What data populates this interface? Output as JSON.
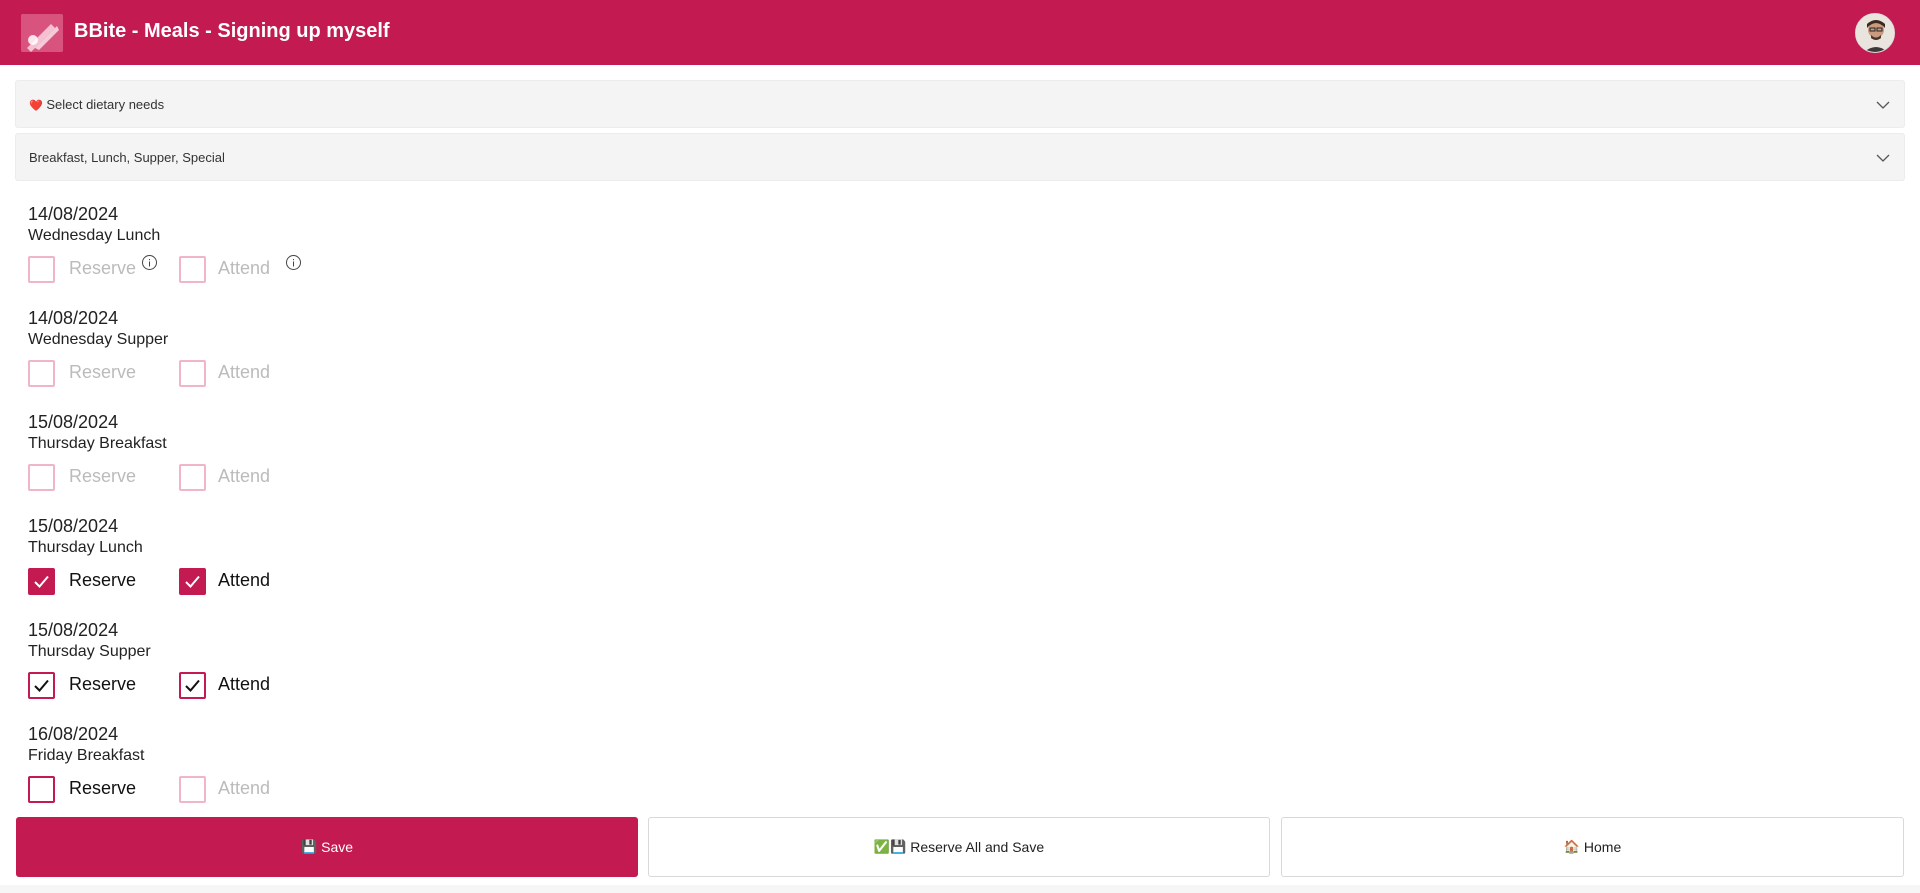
{
  "app": {
    "title": "BBite - Meals - Signing up myself"
  },
  "panels": {
    "dietary_icon": "❤️",
    "dietary_label": "Select dietary needs",
    "meal_types_label": "Breakfast, Lunch, Supper, Special"
  },
  "meals": [
    {
      "date": "14/08/2024",
      "name": "Wednesday Lunch",
      "reserve_label": "Reserve",
      "attend_label": "Attend",
      "reserve_checked": false,
      "attend_checked": false,
      "info_icons": true
    },
    {
      "date": "14/08/2024",
      "name": "Wednesday Supper",
      "reserve_label": "Reserve",
      "attend_label": "Attend",
      "reserve_checked": false,
      "attend_checked": false
    },
    {
      "date": "15/08/2024",
      "name": "Thursday Breakfast",
      "reserve_label": "Reserve",
      "attend_label": "Attend",
      "reserve_checked": false,
      "attend_checked": false
    },
    {
      "date": "15/08/2024",
      "name": "Thursday Lunch",
      "reserve_label": "Reserve",
      "attend_label": "Attend",
      "reserve_checked": true,
      "attend_checked": true
    },
    {
      "date": "15/08/2024",
      "name": "Thursday Supper",
      "reserve_label": "Reserve",
      "attend_label": "Attend",
      "reserve_checked": true,
      "attend_checked": true
    },
    {
      "date": "16/08/2024",
      "name": "Friday Breakfast",
      "reserve_label": "Reserve",
      "attend_label": "Attend",
      "reserve_checked": false,
      "attend_checked": false
    }
  ],
  "buttons": {
    "save_icon": "💾",
    "save_label": "Save",
    "reserve_all_icon": "✅💾",
    "reserve_all_label": "Reserve All and Save",
    "home_icon": "🏠",
    "home_label": "Home"
  },
  "colors": {
    "brand": "#c21a51",
    "disabled_border": "#f0b5c7"
  }
}
